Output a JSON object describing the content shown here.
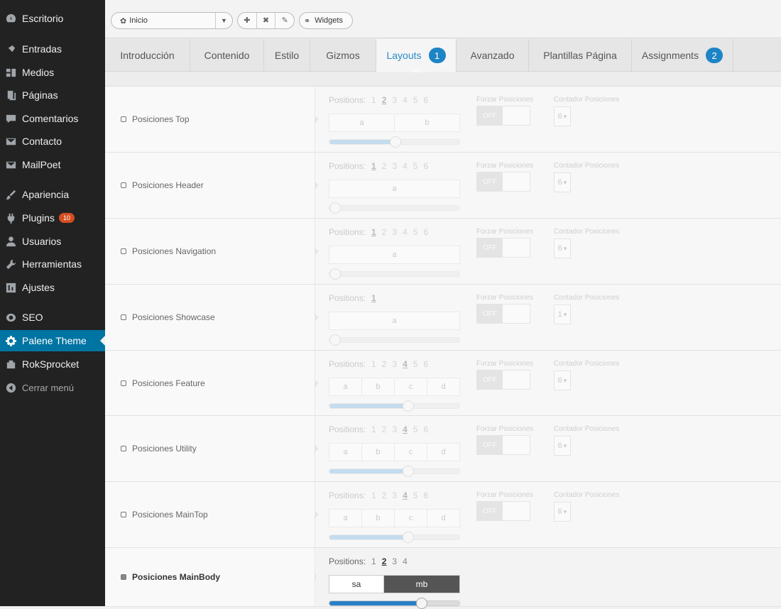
{
  "sidebar": {
    "items": [
      {
        "label": "Escritorio",
        "icon": "dashboard-icon"
      },
      {
        "label": "Entradas",
        "icon": "pin-icon"
      },
      {
        "label": "Medios",
        "icon": "media-icon"
      },
      {
        "label": "Páginas",
        "icon": "pages-icon"
      },
      {
        "label": "Comentarios",
        "icon": "comment-icon"
      },
      {
        "label": "Contacto",
        "icon": "mail-icon"
      },
      {
        "label": "MailPoet",
        "icon": "mail-icon"
      },
      {
        "label": "Apariencia",
        "icon": "brush-icon"
      },
      {
        "label": "Plugins",
        "icon": "plug-icon",
        "badge": "10"
      },
      {
        "label": "Usuarios",
        "icon": "user-icon"
      },
      {
        "label": "Herramientas",
        "icon": "wrench-icon"
      },
      {
        "label": "Ajustes",
        "icon": "settings-icon"
      },
      {
        "label": "SEO",
        "icon": "seo-icon"
      },
      {
        "label": "Palene Theme",
        "icon": "gear-icon",
        "active": true
      },
      {
        "label": "RokSprocket",
        "icon": "rocket-icon"
      },
      {
        "label": "Cerrar menú",
        "icon": "collapse-icon"
      }
    ]
  },
  "toolbar": {
    "preset_value": "Inicio",
    "widgets_label": "Widgets"
  },
  "tabs": [
    {
      "label": "Introducción"
    },
    {
      "label": "Contenido"
    },
    {
      "label": "Estilo"
    },
    {
      "label": "Gizmos"
    },
    {
      "label": "Layouts",
      "count": "1",
      "active": true
    },
    {
      "label": "Avanzado"
    },
    {
      "label": "Plantillas Página"
    },
    {
      "label": "Assignments",
      "count": "2"
    }
  ],
  "rows": [
    {
      "label": "Posiciones Top",
      "positions_label": "Positions:",
      "numbers": [
        "1",
        "2",
        "3",
        "4",
        "5",
        "6"
      ],
      "selected": "2",
      "cells": [
        "a",
        "b"
      ],
      "slider_fraction": 0.5,
      "force_label": "Forzar Posiciones",
      "force_value": "OFF",
      "count_label": "Contador Posiciones",
      "count_value": "6"
    },
    {
      "label": "Posiciones Header",
      "positions_label": "Positions:",
      "numbers": [
        "1",
        "2",
        "3",
        "4",
        "5",
        "6"
      ],
      "selected": "1",
      "cells": [
        "a"
      ],
      "slider_fraction": 0.0,
      "force_label": "Forzar Posiciones",
      "force_value": "OFF",
      "count_label": "Contador Posiciones",
      "count_value": "6"
    },
    {
      "label": "Posiciones Navigation",
      "positions_label": "Positions:",
      "numbers": [
        "1",
        "2",
        "3",
        "4",
        "5",
        "6"
      ],
      "selected": "1",
      "cells": [
        "a"
      ],
      "slider_fraction": 0.0,
      "force_label": "Forzar Posiciones",
      "force_value": "OFF",
      "count_label": "Contador Posiciones",
      "count_value": "6"
    },
    {
      "label": "Posiciones Showcase",
      "positions_label": "Positions:",
      "numbers": [
        "1"
      ],
      "selected": "1",
      "cells": [
        "a"
      ],
      "slider_fraction": 0.0,
      "force_label": "Forzar Posiciones",
      "force_value": "OFF",
      "count_label": "Contador Posiciones",
      "count_value": "1"
    },
    {
      "label": "Posiciones Feature",
      "positions_label": "Positions:",
      "numbers": [
        "1",
        "2",
        "3",
        "4",
        "5",
        "6"
      ],
      "selected": "4",
      "cells": [
        "a",
        "b",
        "c",
        "d"
      ],
      "slider_fraction": 0.6,
      "force_label": "Forzar Posiciones",
      "force_value": "OFF",
      "count_label": "Contador Posiciones",
      "count_value": "6"
    },
    {
      "label": "Posiciones Utility",
      "positions_label": "Positions:",
      "numbers": [
        "1",
        "2",
        "3",
        "4",
        "5",
        "6"
      ],
      "selected": "4",
      "cells": [
        "a",
        "b",
        "c",
        "d"
      ],
      "slider_fraction": 0.6,
      "force_label": "Forzar Posiciones",
      "force_value": "OFF",
      "count_label": "Contador Posiciones",
      "count_value": "6"
    },
    {
      "label": "Posiciones MainTop",
      "positions_label": "Positions:",
      "numbers": [
        "1",
        "2",
        "3",
        "4",
        "5",
        "6"
      ],
      "selected": "4",
      "cells": [
        "a",
        "b",
        "c",
        "d"
      ],
      "slider_fraction": 0.6,
      "force_label": "Forzar Posiciones",
      "force_value": "OFF",
      "count_label": "Contador Posiciones",
      "count_value": "6"
    },
    {
      "label": "Posiciones MainBody",
      "positions_label": "Positions:",
      "numbers": [
        "1",
        "2",
        "3",
        "4"
      ],
      "selected": "2",
      "cells": [
        "sa",
        "mb"
      ],
      "slider_fraction": 0.7,
      "checked": true
    }
  ]
}
